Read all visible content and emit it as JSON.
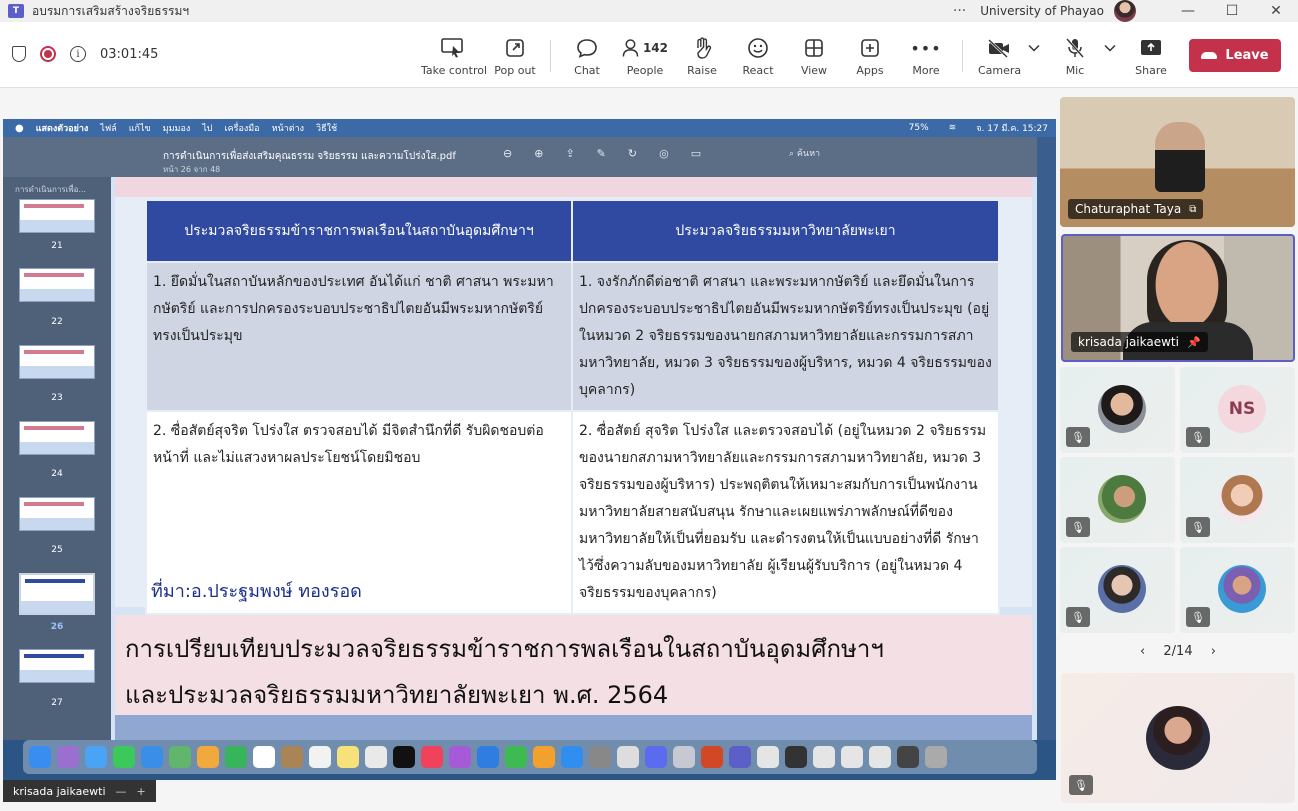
{
  "window": {
    "title": "อบรมการเสริมสร้างจริยธรรมฯ",
    "org": "University of Phayao",
    "more": "···",
    "minimize": "—",
    "maximize": "☐",
    "close": "✕"
  },
  "toolbar": {
    "timer": "03:01:45",
    "take_control": "Take control",
    "pop_out": "Pop out",
    "chat": "Chat",
    "people": "People",
    "people_count": "142",
    "raise": "Raise",
    "react": "React",
    "view": "View",
    "apps": "Apps",
    "more": "More",
    "camera": "Camera",
    "mic": "Mic",
    "share": "Share",
    "leave": "Leave",
    "leave_color": "#c4314b"
  },
  "shared_screen": {
    "mac_menu": [
      "แสดงตัวอย่าง",
      "ไฟล์",
      "แก้ไข",
      "มุมมอง",
      "ไป",
      "เครื่องมือ",
      "หน้าต่าง",
      "วิธีใช้"
    ],
    "mac_status": {
      "battery": "75%",
      "datetime": "จ. 17 มี.ค. 15:27"
    },
    "file_name": "การดำเนินการเพื่อส่งเสริมคุณธรรม จริยธรรม และความโปร่งใส.pdf",
    "page_indicator": "หน้า 26 จาก 48",
    "search_placeholder": "ค้นหา",
    "sidebar_title": "การดำเนินการเพื่อ...",
    "thumbnails": [
      "21",
      "22",
      "23",
      "24",
      "25",
      "26",
      "27"
    ],
    "selected_thumbnail": "26",
    "table": {
      "headers": [
        "ประมวลจริยธรรมข้าราชการพลเรือนในสถาบันอุดมศึกษาฯ",
        "ประมวลจริยธรรมมหาวิทยาลัยพะเยา"
      ],
      "row1": [
        "1. ยึดมั่นในสถาบันหลักของประเทศ อันได้แก่ ชาติ ศาสนา พระมหากษัตริย์ และการปกครองระบอบประชาธิปไตยอันมีพระมหากษัตริย์ทรงเป็นประมุข",
        "1. จงรักภักดีต่อชาติ ศาสนา และพระมหากษัตริย์ และยึดมั่นในการปกครองระบอบประชาธิปไตยอันมีพระมหากษัตริย์ทรงเป็นประมุข (อยู่ในหมวด 2 จริยธรรมของนายกสภามหาวิทยาลัยและกรรมการสภามหาวิทยาลัย, หมวด 3 จริยธรรมของผู้บริหาร, หมวด 4 จริยธรรมของบุคลากร)"
      ],
      "row2": [
        "2. ซื่อสัตย์สุจริต โปร่งใส ตรวจสอบได้ มีจิตสำนึกที่ดี รับผิดชอบต่อหน้าที่ และไม่แสวงหาผลประโยชน์โดยมิชอบ",
        "2. ซื่อสัตย์ สุจริต โปร่งใส และตรวจสอบได้ (อยู่ในหมวด 2 จริยธรรมของนายกสภามหาวิทยาลัยและกรรมการสภามหาวิทยาลัย, หมวด 3 จริยธรรมของผู้บริหาร) ประพฤติตนให้เหมาะสมกับการเป็นพนักงานมหาวิทยาลัยสายสนับสนุน รักษาและเผยแพร่ภาพลักษณ์ที่ดีของมหาวิทยาลัยให้เป็นที่ยอมรับ และดำรงตนให้เป็นแบบอย่างที่ดี รักษาไว้ซึ่งความลับของมหาวิทยาลัย ผู้เรียนผู้รับบริการ (อยู่ในหมวด 4 จริยธรรมของบุคลากร)"
      ]
    },
    "source": "ที่มา:อ.ประฐมพงษ์ ทองรอด",
    "slide2_line1": "การเปรียบเทียบประมวลจริยธรรมข้าราชการพลเรือนในสถาบันอุดมศึกษาฯ",
    "slide2_line2": "และประมวลจริยธรรมมหาวิทยาลัยพะเยา พ.ศ. 2564"
  },
  "participants": {
    "video1_name": "Chaturaphat Taya",
    "video2_name": "krisada jaikaewti",
    "ns_initials": "NS",
    "page": "2/14"
  },
  "footer": {
    "presenter": "krisada jaikaewti",
    "minus": "—",
    "plus": "+"
  }
}
